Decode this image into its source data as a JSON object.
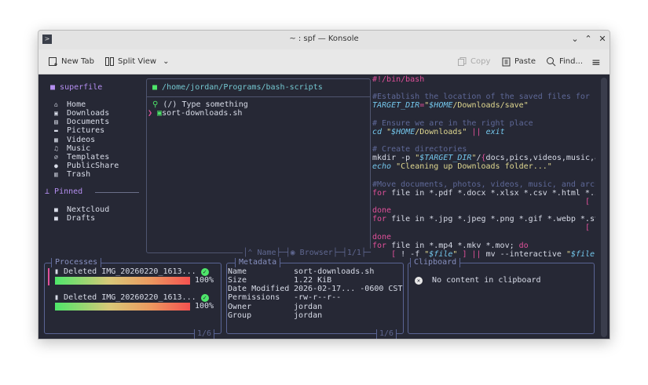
{
  "window": {
    "title": "~ : spf — Konsole"
  },
  "toolbar": {
    "new_tab": "New Tab",
    "split_view": "Split View",
    "copy": "Copy",
    "paste": "Paste",
    "find": "Find..."
  },
  "sidebar": {
    "title": "superfile",
    "items": [
      {
        "icon": "home-icon",
        "glyph": "⌂",
        "label": "Home"
      },
      {
        "icon": "download-icon",
        "glyph": "▣",
        "label": "Downloads"
      },
      {
        "icon": "document-icon",
        "glyph": "▤",
        "label": "Documents"
      },
      {
        "icon": "picture-icon",
        "glyph": "▬",
        "label": "Pictures"
      },
      {
        "icon": "video-icon",
        "glyph": "▦",
        "label": "Videos"
      },
      {
        "icon": "music-icon",
        "glyph": "♫",
        "label": "Music"
      },
      {
        "icon": "paperclip-icon",
        "glyph": "∅",
        "label": "Templates"
      },
      {
        "icon": "globe-icon",
        "glyph": "●",
        "label": "PublicShare"
      },
      {
        "icon": "trash-icon",
        "glyph": "▥",
        "label": "Trash"
      }
    ],
    "pinned_title": "Pinned",
    "pinned": [
      {
        "label": "Nextcloud"
      },
      {
        "label": "Drafts"
      }
    ]
  },
  "file_panel": {
    "path": "/home/jordan/Programs/bash-scripts",
    "search_placeholder": "(/) Type something",
    "files": [
      "sort-downloads.sh"
    ],
    "sort_label": "Name",
    "mode_label": "Browser",
    "page": "1/1"
  },
  "preview": {
    "lines": [
      [
        [
          "#!/bin/bash",
          "k"
        ]
      ],
      [],
      [
        [
          "#Establish the location of the saved files for r",
          "c"
        ]
      ],
      [
        [
          "TARGET_DIR",
          "v"
        ],
        [
          "=",
          "k"
        ],
        [
          "\"",
          "s"
        ],
        [
          "$HOME",
          "v"
        ],
        [
          "/Downloads/save\"",
          "s"
        ]
      ],
      [],
      [
        [
          "# Ensure we are in the right place",
          "c"
        ]
      ],
      [
        [
          "cd",
          "v"
        ],
        [
          " ",
          ""
        ],
        [
          "\"",
          "s"
        ],
        [
          "$HOME",
          "v"
        ],
        [
          "/Downloads\"",
          "s"
        ],
        [
          " ",
          ""
        ],
        [
          "||",
          "k"
        ],
        [
          " ",
          ""
        ],
        [
          "exit",
          "v"
        ]
      ],
      [],
      [
        [
          "# Create directories",
          "c"
        ]
      ],
      [
        [
          "mkdir -p ",
          ""
        ],
        [
          "\"",
          "s"
        ],
        [
          "$TARGET_DIR",
          "v"
        ],
        [
          "\"",
          "s"
        ],
        [
          "/",
          ""
        ],
        [
          "{",
          "k"
        ],
        [
          "docs,pics,videos,music,a",
          ""
        ]
      ],
      [
        [
          "echo",
          "v"
        ],
        [
          " \"Cleaning up Downloads folder...\"",
          "s"
        ]
      ],
      [],
      [
        [
          "#Move documents, photos, videos, music, and arch",
          "c"
        ]
      ],
      [
        [
          "for",
          "k"
        ],
        [
          " file in *.pdf *.docx *.xlsx *.csv *.html *.i",
          ""
        ]
      ],
      [
        [
          "                                             ",
          ""
        ],
        [
          "[",
          "k"
        ],
        [
          " !",
          ""
        ]
      ],
      [
        [
          "done",
          "k"
        ]
      ],
      [
        [
          "for",
          "k"
        ],
        [
          " file in *.jpg *.jpeg *.png *.gif *.webp *.sv",
          ""
        ]
      ],
      [
        [
          "                                             ",
          ""
        ],
        [
          "[",
          "k"
        ],
        [
          " !",
          ""
        ]
      ],
      [
        [
          "done",
          "k"
        ]
      ],
      [
        [
          "for",
          "k"
        ],
        [
          " file in *.mp4 *.mkv *.mov; ",
          ""
        ],
        [
          "do",
          "k"
        ]
      ],
      [
        [
          "    ",
          ""
        ],
        [
          "[",
          "k"
        ],
        [
          " ! -f ",
          ""
        ],
        [
          "\"",
          "s"
        ],
        [
          "$file",
          "v"
        ],
        [
          "\"",
          "s"
        ],
        [
          " ",
          ""
        ],
        [
          "]",
          "k"
        ],
        [
          " ",
          ""
        ],
        [
          "||",
          "k"
        ],
        [
          " mv --interactive ",
          ""
        ],
        [
          "\"",
          "s"
        ],
        [
          "$file",
          "v"
        ],
        [
          "\"",
          "s"
        ]
      ]
    ]
  },
  "processes": {
    "title": "Processes",
    "items": [
      {
        "label": "Deleted IMG_20260220_1613...",
        "progress": 100,
        "percent": "100%"
      },
      {
        "label": "Deleted IMG_20260220_1613...",
        "progress": 100,
        "percent": "100%"
      }
    ],
    "page": "1/6"
  },
  "metadata": {
    "title": "Metadata",
    "rows": [
      [
        "Name",
        "sort-downloads.sh"
      ],
      [
        "Size",
        "1.22 KiB"
      ],
      [
        "Date Modified",
        "2026-02-17... -0600 CST"
      ],
      [
        "Permissions",
        "-rw-r--r--"
      ],
      [
        "Owner",
        "jordan"
      ],
      [
        "Group",
        "jordan"
      ]
    ],
    "page": "1/6"
  },
  "clipboard": {
    "title": "Clipboard",
    "empty": "No content in clipboard"
  }
}
